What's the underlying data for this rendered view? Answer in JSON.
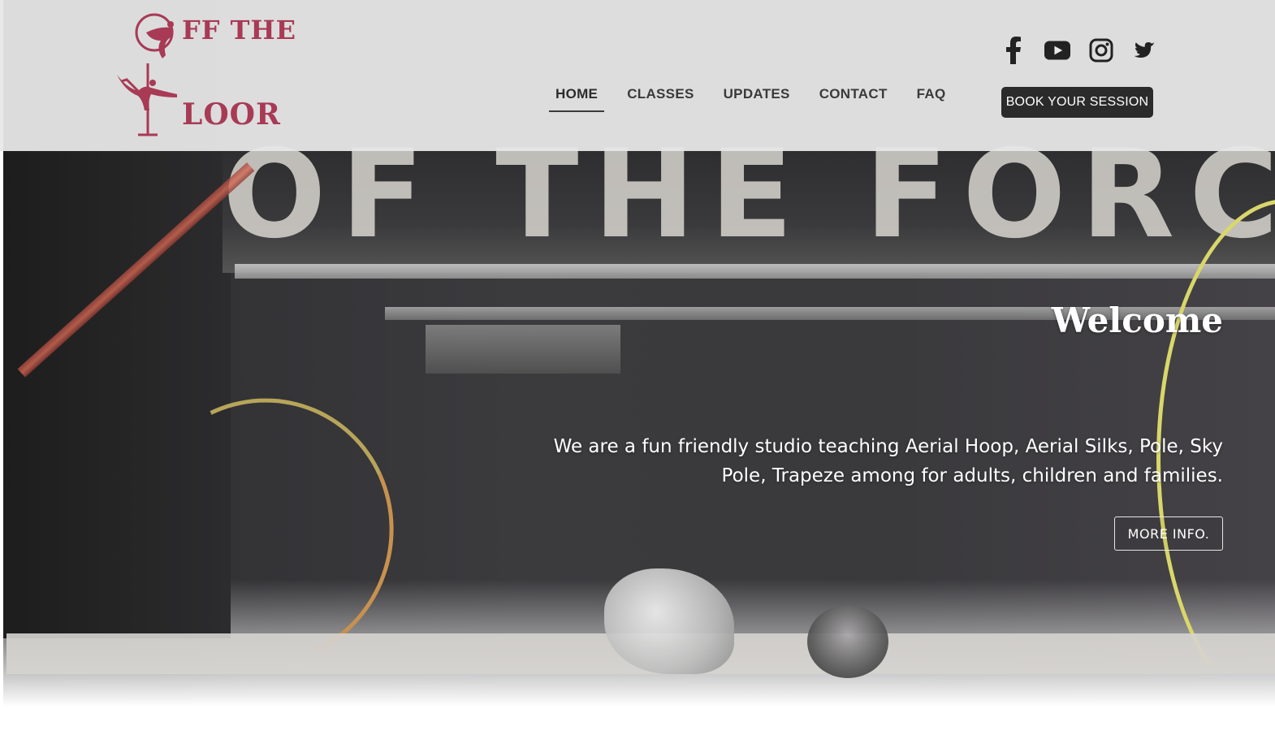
{
  "header": {
    "logo": {
      "line1": "FF THE",
      "line2": "LOOR",
      "color": "#a83a55"
    },
    "nav": {
      "items": [
        {
          "label": "HOME",
          "active": true
        },
        {
          "label": "CLASSES",
          "active": false
        },
        {
          "label": "UPDATES",
          "active": false
        },
        {
          "label": "CONTACT",
          "active": false
        },
        {
          "label": "FAQ",
          "active": false
        }
      ]
    },
    "social": {
      "icons": [
        "facebook-icon",
        "youtube-icon",
        "instagram-icon",
        "twitter-icon"
      ]
    },
    "book_button": "BOOK YOUR SESSION"
  },
  "hero": {
    "background_text": "OF THE FORCE",
    "title": "Welcome",
    "intro": "We are a fun friendly studio teaching Aerial Hoop, Aerial Silks, Pole, Sky Pole, Trapeze among for adults, children and families.",
    "more_button": "MORE INFO."
  },
  "colors": {
    "accent": "#a83a55",
    "dark": "#2b2b2b",
    "nav_text": "#3a3a3a"
  }
}
